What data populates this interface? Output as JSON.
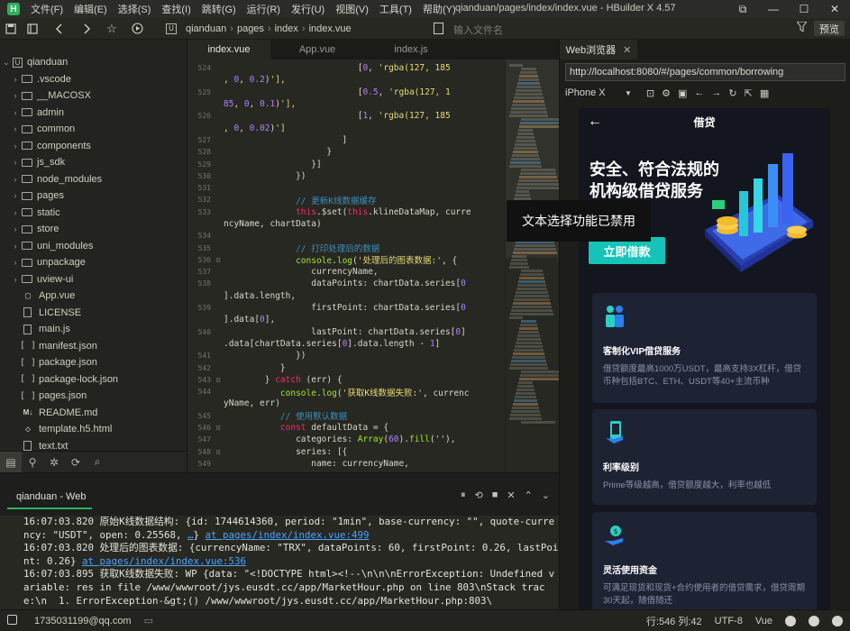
{
  "menubar": {
    "logo": "H",
    "items": [
      "文件(F)",
      "编辑(E)",
      "选择(S)",
      "查找(I)",
      "跳转(G)",
      "运行(R)",
      "发行(U)",
      "视图(V)",
      "工具(T)",
      "帮助(Y)"
    ],
    "window_title": "qianduan/pages/index/index.vue - HBuilder X 4.57",
    "controls": [
      "⧉",
      "—",
      "☐",
      "✕"
    ]
  },
  "toolbar": {
    "icons": [
      "save-icon",
      "sidebar-icon",
      "back-icon",
      "forward-icon",
      "star-icon",
      "run-icon"
    ],
    "project_badge": "U",
    "breadcrumb": [
      "qianduan",
      "pages",
      "index",
      "index.vue"
    ],
    "file_search_placeholder": "输入文件名",
    "preview_label": "预览"
  },
  "sidebar": {
    "root": "qianduan",
    "items": [
      {
        "label": ".vscode",
        "type": "folder"
      },
      {
        "label": "__MACOSX",
        "type": "folder"
      },
      {
        "label": "admin",
        "type": "folder"
      },
      {
        "label": "common",
        "type": "folder"
      },
      {
        "label": "components",
        "type": "folder"
      },
      {
        "label": "js_sdk",
        "type": "folder"
      },
      {
        "label": "node_modules",
        "type": "folder"
      },
      {
        "label": "pages",
        "type": "folder"
      },
      {
        "label": "static",
        "type": "folder"
      },
      {
        "label": "store",
        "type": "folder"
      },
      {
        "label": "uni_modules",
        "type": "folder"
      },
      {
        "label": "unpackage",
        "type": "folder"
      },
      {
        "label": "uview-ui",
        "type": "folder"
      },
      {
        "label": "App.vue",
        "type": "vue"
      },
      {
        "label": "LICENSE",
        "type": "file"
      },
      {
        "label": "main.js",
        "type": "file"
      },
      {
        "label": "manifest.json",
        "type": "json"
      },
      {
        "label": "package.json",
        "type": "json"
      },
      {
        "label": "package-lock.json",
        "type": "json"
      },
      {
        "label": "pages.json",
        "type": "json"
      },
      {
        "label": "README.md",
        "type": "md"
      },
      {
        "label": "template.h5.html",
        "type": "html"
      },
      {
        "label": "text.txt",
        "type": "file"
      }
    ]
  },
  "tabs": [
    {
      "label": "index.vue",
      "active": true
    },
    {
      "label": "App.vue",
      "active": false
    },
    {
      "label": "index.js",
      "active": false
    }
  ],
  "editor": {
    "lines": [
      {
        "n": "524",
        "f": "",
        "t": "                          [0, 'rgba(127, 185"
      },
      {
        "n": "",
        "f": "",
        "t": ", 0, 0.2)'],"
      },
      {
        "n": "525",
        "f": "",
        "t": "                          [0.5, 'rgba(127, 1"
      },
      {
        "n": "",
        "f": "",
        "t": "85, 0, 0.1)'],"
      },
      {
        "n": "526",
        "f": "",
        "t": "                          [1, 'rgba(127, 185"
      },
      {
        "n": "",
        "f": "",
        "t": ", 0, 0.02)']"
      },
      {
        "n": "527",
        "f": "",
        "t": "                       ]"
      },
      {
        "n": "528",
        "f": "",
        "t": "                    }"
      },
      {
        "n": "529",
        "f": "",
        "t": "                 }]"
      },
      {
        "n": "530",
        "f": "",
        "t": "              })"
      },
      {
        "n": "531",
        "f": "",
        "t": ""
      },
      {
        "n": "532",
        "f": "",
        "t": "              // 更新K线数据缓存"
      },
      {
        "n": "533",
        "f": "",
        "t": "              this.$set(this.klineDataMap, curre"
      },
      {
        "n": "",
        "f": "",
        "t": "ncyName, chartData)"
      },
      {
        "n": "534",
        "f": "",
        "t": ""
      },
      {
        "n": "535",
        "f": "",
        "t": "              // 打印处理后的数据"
      },
      {
        "n": "536",
        "f": "⊟",
        "t": "              console.log('处理后的图表数据:', {"
      },
      {
        "n": "537",
        "f": "",
        "t": "                 currencyName,"
      },
      {
        "n": "538",
        "f": "",
        "t": "                 dataPoints: chartData.series[0"
      },
      {
        "n": "",
        "f": "",
        "t": "].data.length,"
      },
      {
        "n": "539",
        "f": "",
        "t": "                 firstPoint: chartData.series[0"
      },
      {
        "n": "",
        "f": "",
        "t": "].data[0],"
      },
      {
        "n": "540",
        "f": "",
        "t": "                 lastPoint: chartData.series[0]"
      },
      {
        "n": "",
        "f": "",
        "t": ".data[chartData.series[0].data.length - 1]"
      },
      {
        "n": "541",
        "f": "",
        "t": "              })"
      },
      {
        "n": "542",
        "f": "",
        "t": "           }"
      },
      {
        "n": "543",
        "f": "⊟",
        "t": "        } catch (err) {"
      },
      {
        "n": "544",
        "f": "",
        "t": "           console.log('获取K线数据失败:', currenc"
      },
      {
        "n": "",
        "f": "",
        "t": "yName, err)"
      },
      {
        "n": "545",
        "f": "",
        "t": "           // 使用默认数据"
      },
      {
        "n": "546",
        "f": "⊟",
        "t": "           const defaultData = {"
      },
      {
        "n": "547",
        "f": "",
        "t": "              categories: Array(60).fill(''),"
      },
      {
        "n": "548",
        "f": "⊟",
        "t": "              series: [{"
      },
      {
        "n": "549",
        "f": "",
        "t": "                 name: currencyName,"
      }
    ]
  },
  "toast": "文本选择功能已禁用",
  "console": {
    "title": "qianduan - Web",
    "tools": [
      "⏸",
      "⟲",
      "■",
      "✕",
      "⌃",
      "⌄"
    ],
    "logs": [
      {
        "text": "16:07:03.820 原始K线数据结构: {id: 1744614360, period: \"1min\", base-currency: \"\", quote-currency: \"USDT\", open: 0.25568, ",
        "link1": "…",
        "mid": "} ",
        "link": "at pages/index/index.vue:499"
      },
      {
        "text": "16:07:03.820 处理后的图表数据: {currencyName: \"TRX\", dataPoints: 60, firstPoint: 0.26, lastPoint: 0.26} ",
        "link1": "",
        "mid": "",
        "link": "at pages/index/index.vue:536"
      },
      {
        "text": "16:07:03.895 获取K线数据失败: WP {data: \"<!DOCTYPE html><!--\\n\\n\\nErrorException: Undefined variable: res in file /www/wwwroot/jys.eusdt.cc/app/MarketHour.php on line 803\\nStack trace:\\n  1. ErrorException-&gt;() /www/wwwroot/jys.eusdt.cc/app/MarketHour.php:803\\",
        "link1": "",
        "mid": "",
        "link": ""
      }
    ]
  },
  "status": {
    "user": "1735031199@qq.com",
    "position": "行:546  列:42",
    "encoding": "UTF-8",
    "language": "Vue"
  },
  "browser": {
    "tab_label": "Web浏览器",
    "url": "http://localhost:8080/#/pages/common/borrowing",
    "device": "iPhone X",
    "device_icons": [
      "screenshot-icon",
      "settings-icon",
      "console-icon",
      "back-icon",
      "forward-icon",
      "refresh-icon",
      "open-external-icon",
      "qrcode-icon"
    ]
  },
  "phone": {
    "header_title": "借贷",
    "hero_title": "安全、符合法规的机构级借贷服务",
    "hero_button": "立即借款",
    "cards": [
      {
        "title": "客制化VIP借贷服务",
        "desc": "借贷额度最高1000万USDT，最高支持3X杠杆，借贷币种包括BTC、ETH、USDT等40+主流币种"
      },
      {
        "title": "利率级别",
        "desc": "Prime等级越高，借贷额度越大，利率也越低"
      },
      {
        "title": "灵活使用资金",
        "desc": "可满足现货和现货+合约使用者的借贷需求，借贷周期30天起，随借随还"
      }
    ]
  },
  "colors": {
    "accent": "#2fb15c",
    "hero_button": "#16c3b8",
    "card_bg": "#1e2334",
    "link": "#4aa3ff"
  }
}
